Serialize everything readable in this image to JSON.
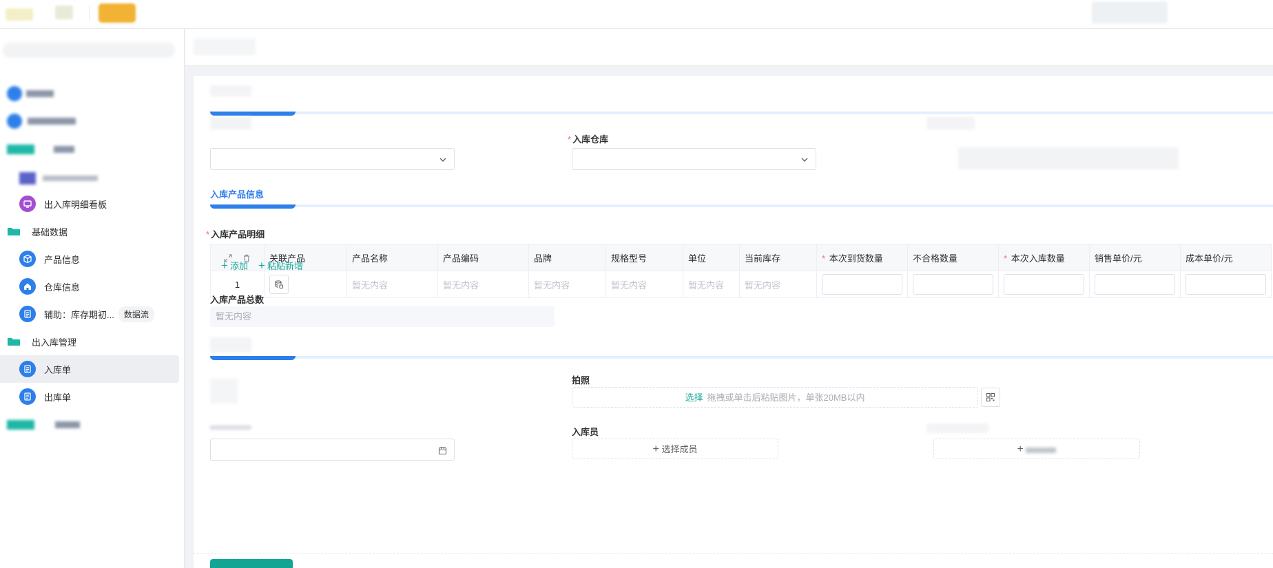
{
  "sidebar": {
    "items": [
      {
        "label": "出入库明细看板"
      },
      {
        "label": "基础数据"
      },
      {
        "label": "产品信息"
      },
      {
        "label": "仓库信息"
      },
      {
        "label": "辅助：库存期初...",
        "tag": "数据流"
      },
      {
        "label": "出入库管理"
      },
      {
        "label": "入库单",
        "active": true
      },
      {
        "label": "出库单"
      }
    ]
  },
  "form": {
    "warehouse_label": "入库仓库",
    "product_section_title": "入库产品信息",
    "detail_label": "入库产品明细",
    "table": {
      "headers": [
        "关联产品",
        "产品名称",
        "产品编码",
        "品牌",
        "规格型号",
        "单位",
        "当前库存",
        "本次到货数量",
        "不合格数量",
        "本次入库数量",
        "销售单价/元",
        "成本单价/元"
      ],
      "rows": [
        {
          "index": "1",
          "name": "暂无内容",
          "code": "暂无内容",
          "brand": "暂无内容",
          "spec": "暂无内容",
          "unit": "暂无内容",
          "stock": "暂无内容"
        }
      ]
    },
    "add_label": "添加",
    "paste_label": "粘贴新增",
    "total_label": "入库产品总数",
    "total_value": "暂无内容",
    "photo_label": "拍照",
    "photo_pick": "选择",
    "photo_hint": "拖拽或单击后粘贴图片，单张20MB以内",
    "operator_label": "入库员",
    "select_member": "选择成员"
  },
  "colors": {
    "accent": "#2d7fea",
    "teal": "#12a594",
    "required": "#f56c6c"
  }
}
